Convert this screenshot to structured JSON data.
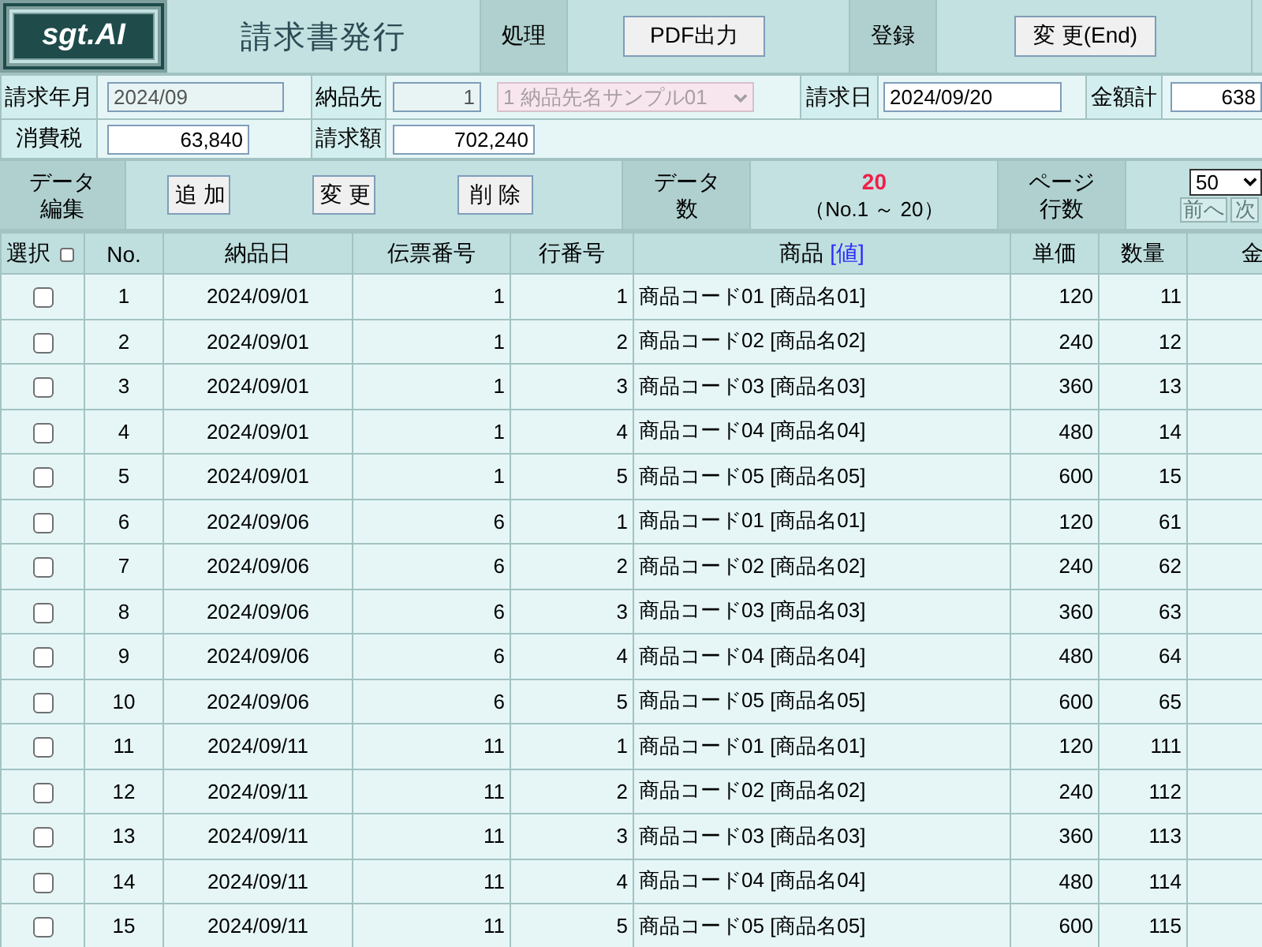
{
  "header": {
    "logo": "sgt.AI",
    "title": "請求書発行",
    "sections": [
      {
        "label": "処理",
        "button": "PDF出力"
      },
      {
        "label": "登録",
        "button": "変 更(End)"
      }
    ]
  },
  "form": [
    {
      "fields": [
        {
          "label": "請求年月",
          "value": "2024/09",
          "kind": "text",
          "readonly": true
        },
        {
          "label": "納品先",
          "value": "1",
          "kind": "number",
          "readonly": true
        },
        {
          "kind": "select",
          "value": "1 納品先名サンプル01",
          "disabled": true
        },
        {
          "label": "請求日",
          "value": "2024/09/20",
          "kind": "text",
          "readonly": false
        },
        {
          "label": "金額計",
          "value": "638",
          "kind": "number",
          "readonly": false
        }
      ]
    },
    {
      "fields": [
        {
          "label": "消費税",
          "value": "63,840",
          "kind": "number",
          "readonly": false
        },
        {
          "label": "請求額",
          "value": "702,240",
          "kind": "number",
          "readonly": false
        }
      ]
    }
  ],
  "toolbar": {
    "edit_label": "データ編集",
    "buttons": [
      "追加",
      "変更",
      "削除"
    ],
    "count_label": "データ数",
    "count": "20",
    "range": "（No.1 ～ 20）",
    "rows_label": "ページ行数",
    "page_size": "50",
    "prev": {
      "label": "前へ",
      "disabled": true
    },
    "next": {
      "label": "次",
      "disabled": true
    }
  },
  "table": {
    "columns": [
      {
        "label": "選択",
        "kind": "checkbox",
        "checked": false
      },
      {
        "label": "No."
      },
      {
        "label": "納品日"
      },
      {
        "label": "伝票番号"
      },
      {
        "label": "行番号"
      },
      {
        "label": "商品",
        "link": "[値]"
      },
      {
        "label": "単価"
      },
      {
        "label": "数量"
      },
      {
        "label": "金"
      }
    ],
    "rows": [
      {
        "checked": false,
        "cells": [
          "",
          "1",
          "2024/09/01",
          "1",
          "1",
          "商品コード01 [商品名01]",
          "120",
          "11"
        ]
      },
      {
        "checked": false,
        "cells": [
          "",
          "2",
          "2024/09/01",
          "1",
          "2",
          "商品コード02 [商品名02]",
          "240",
          "12"
        ]
      },
      {
        "checked": false,
        "cells": [
          "",
          "3",
          "2024/09/01",
          "1",
          "3",
          "商品コード03 [商品名03]",
          "360",
          "13"
        ]
      },
      {
        "checked": false,
        "cells": [
          "",
          "4",
          "2024/09/01",
          "1",
          "4",
          "商品コード04 [商品名04]",
          "480",
          "14"
        ]
      },
      {
        "checked": false,
        "cells": [
          "",
          "5",
          "2024/09/01",
          "1",
          "5",
          "商品コード05 [商品名05]",
          "600",
          "15"
        ]
      },
      {
        "checked": false,
        "cells": [
          "",
          "6",
          "2024/09/06",
          "6",
          "1",
          "商品コード01 [商品名01]",
          "120",
          "61"
        ]
      },
      {
        "checked": false,
        "cells": [
          "",
          "7",
          "2024/09/06",
          "6",
          "2",
          "商品コード02 [商品名02]",
          "240",
          "62"
        ]
      },
      {
        "checked": false,
        "cells": [
          "",
          "8",
          "2024/09/06",
          "6",
          "3",
          "商品コード03 [商品名03]",
          "360",
          "63"
        ]
      },
      {
        "checked": false,
        "cells": [
          "",
          "9",
          "2024/09/06",
          "6",
          "4",
          "商品コード04 [商品名04]",
          "480",
          "64"
        ]
      },
      {
        "checked": false,
        "cells": [
          "",
          "10",
          "2024/09/06",
          "6",
          "5",
          "商品コード05 [商品名05]",
          "600",
          "65"
        ]
      },
      {
        "checked": false,
        "cells": [
          "",
          "11",
          "2024/09/11",
          "11",
          "1",
          "商品コード01 [商品名01]",
          "120",
          "111"
        ]
      },
      {
        "checked": false,
        "cells": [
          "",
          "12",
          "2024/09/11",
          "11",
          "2",
          "商品コード02 [商品名02]",
          "240",
          "112"
        ]
      },
      {
        "checked": false,
        "cells": [
          "",
          "13",
          "2024/09/11",
          "11",
          "3",
          "商品コード03 [商品名03]",
          "360",
          "113"
        ]
      },
      {
        "checked": false,
        "cells": [
          "",
          "14",
          "2024/09/11",
          "11",
          "4",
          "商品コード04 [商品名04]",
          "480",
          "114"
        ]
      },
      {
        "checked": false,
        "cells": [
          "",
          "15",
          "2024/09/11",
          "11",
          "5",
          "商品コード05 [商品名05]",
          "600",
          "115"
        ]
      }
    ]
  }
}
